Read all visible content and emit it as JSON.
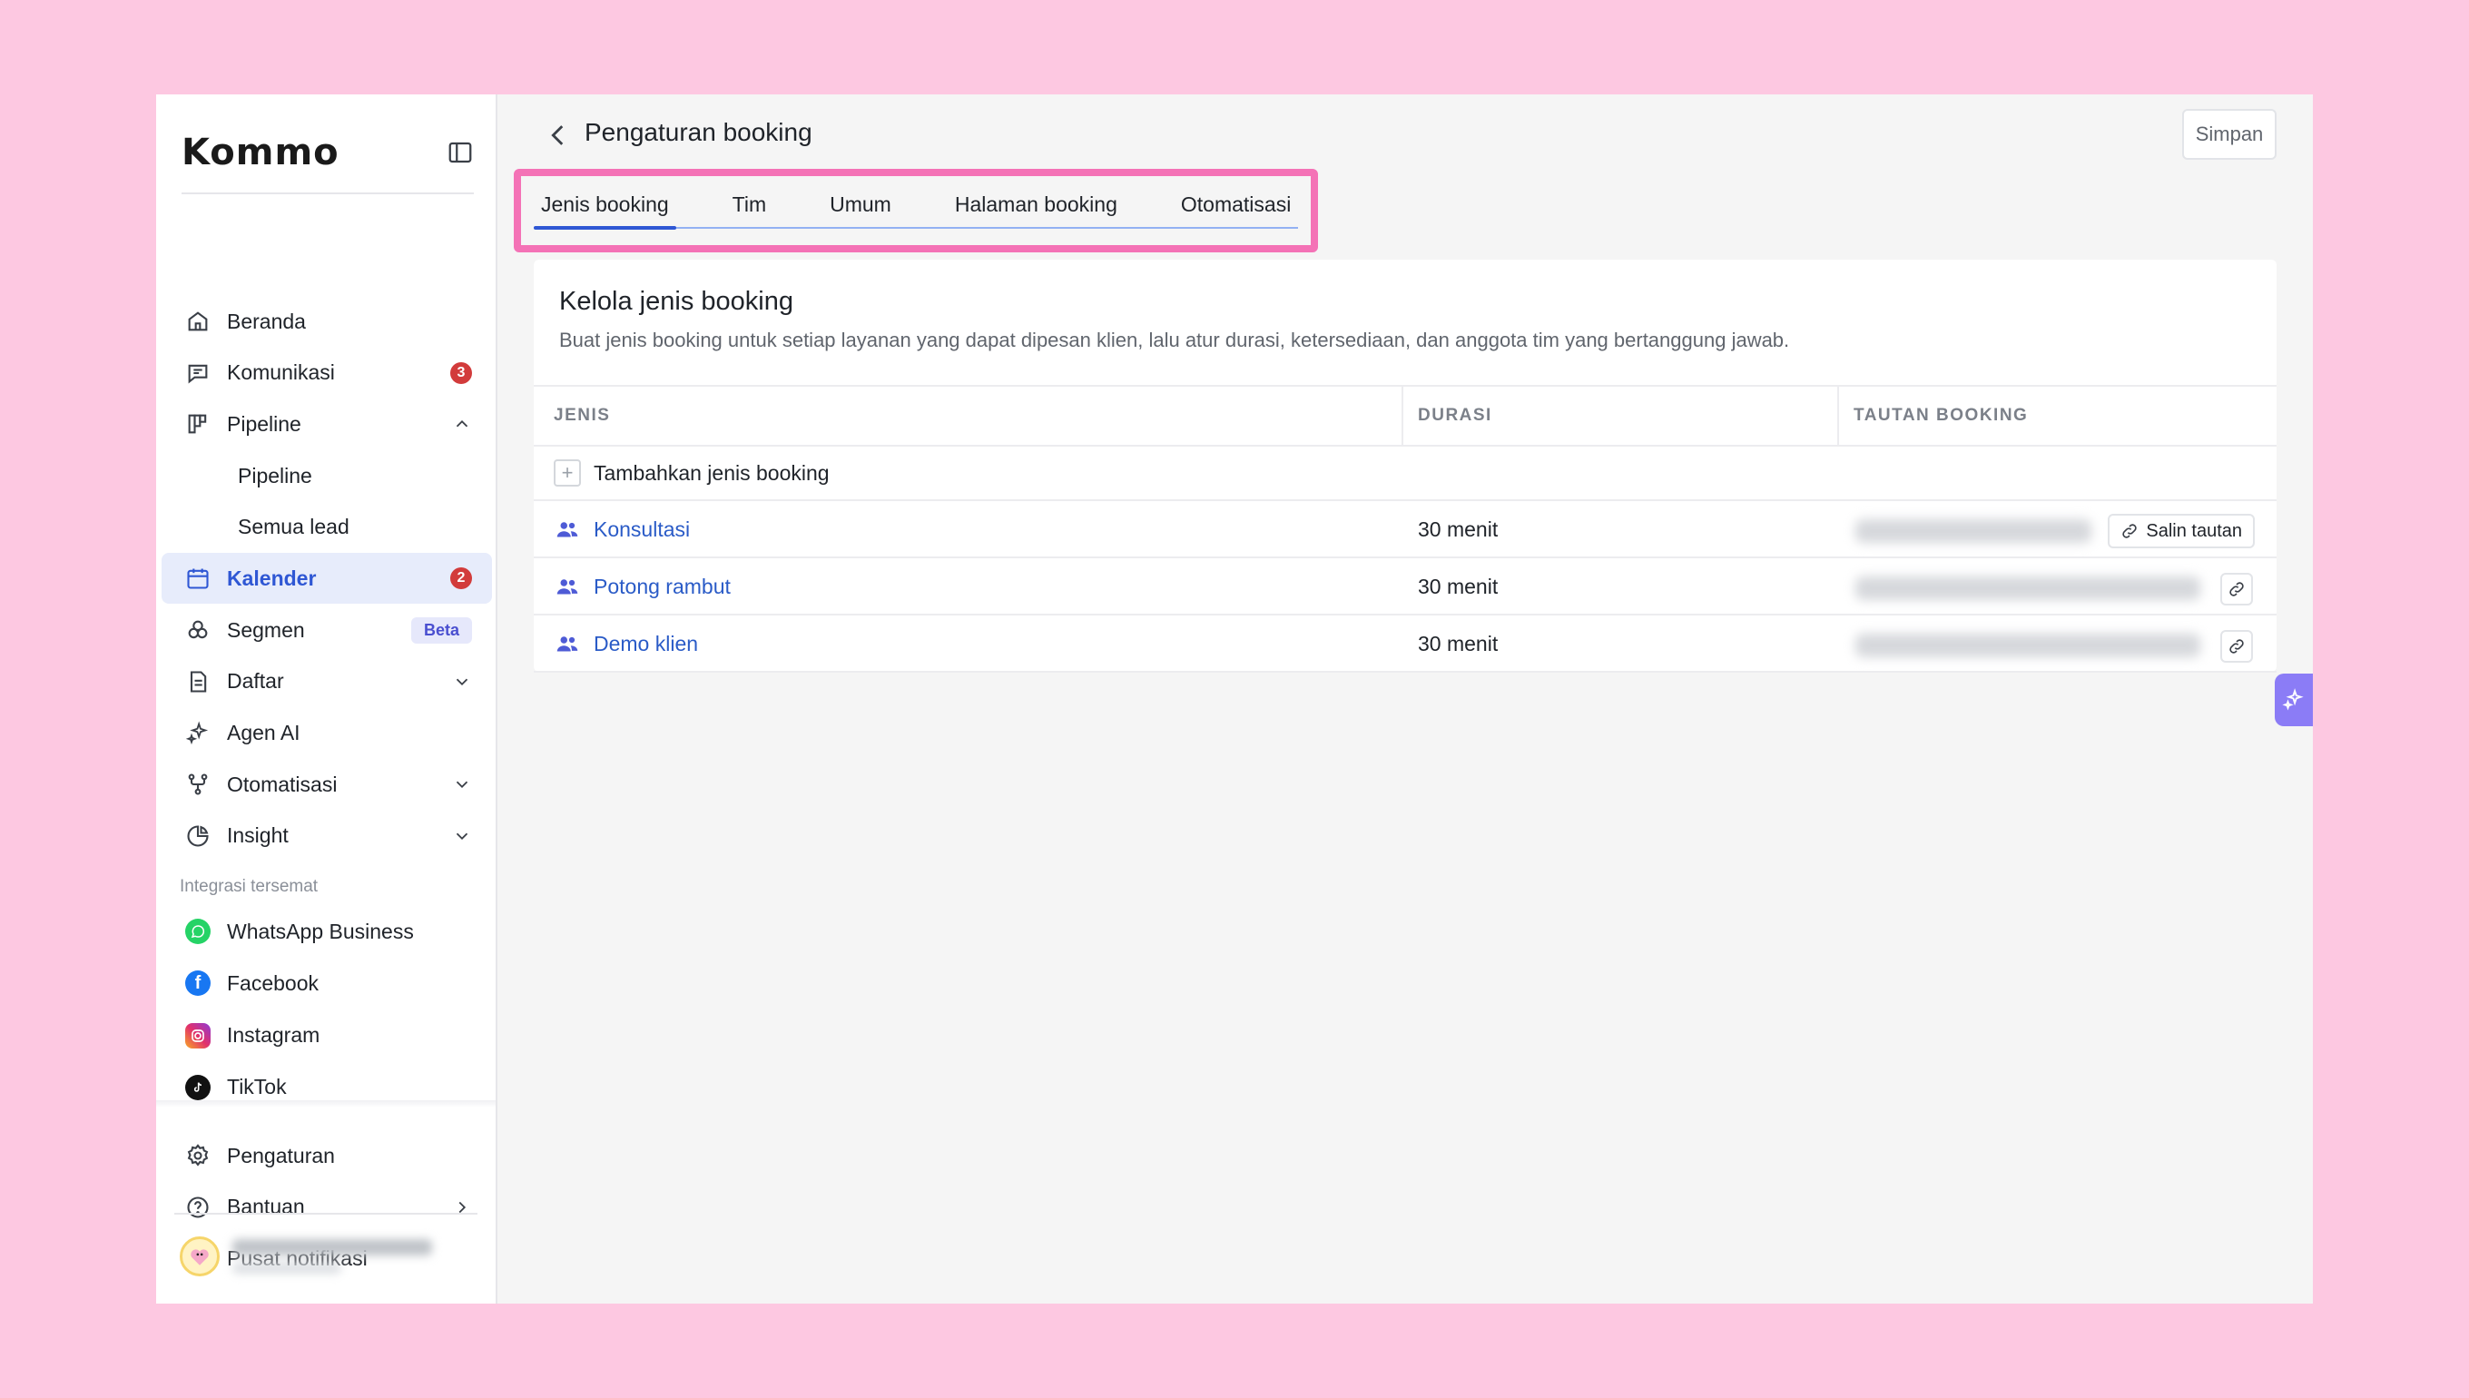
{
  "app": {
    "logo_text": "Kommo"
  },
  "header": {
    "title": "Pengaturan booking",
    "save_label": "Simpan"
  },
  "tabs": [
    {
      "label": "Jenis booking",
      "active": true
    },
    {
      "label": "Tim",
      "active": false
    },
    {
      "label": "Umum",
      "active": false
    },
    {
      "label": "Halaman booking",
      "active": false
    },
    {
      "label": "Otomatisasi",
      "active": false
    }
  ],
  "sidebar": {
    "items": [
      {
        "label": "Beranda",
        "icon": "home-icon"
      },
      {
        "label": "Komunikasi",
        "icon": "chat-icon",
        "badge": "3"
      },
      {
        "label": "Pipeline",
        "icon": "pipeline-icon",
        "expanded": true
      },
      {
        "label": "Pipeline",
        "sub": true
      },
      {
        "label": "Semua lead",
        "sub": true
      },
      {
        "label": "Kalender",
        "icon": "calendar-icon",
        "badge": "2",
        "active": true
      },
      {
        "label": "Segmen",
        "icon": "segment-icon",
        "tag": "Beta"
      },
      {
        "label": "Daftar",
        "icon": "list-icon"
      },
      {
        "label": "Agen AI",
        "icon": "sparkle-icon"
      },
      {
        "label": "Otomatisasi",
        "icon": "automation-icon"
      },
      {
        "label": "Insight",
        "icon": "chart-icon"
      }
    ],
    "integrations_label": "Integrasi tersemat",
    "integrations": [
      {
        "label": "WhatsApp Business",
        "icon": "whatsapp-icon",
        "color": "#25d366"
      },
      {
        "label": "Facebook",
        "icon": "facebook-icon",
        "color": "#1877f2"
      },
      {
        "label": "Instagram",
        "icon": "instagram-icon",
        "color": "#e1306c"
      },
      {
        "label": "TikTok",
        "icon": "tiktok-icon",
        "color": "#111111"
      }
    ],
    "bottom": [
      {
        "label": "Pengaturan",
        "icon": "gear-icon"
      },
      {
        "label": "Bantuan",
        "icon": "help-icon"
      },
      {
        "label": "Pusat notifikasi",
        "icon": "bell-icon"
      }
    ]
  },
  "card": {
    "title": "Kelola jenis booking",
    "description": "Buat jenis booking untuk setiap layanan yang dapat dipesan klien, lalu atur durasi, ketersediaan, dan anggota tim yang bertanggung jawab."
  },
  "table": {
    "columns": [
      "JENIS",
      "DURASI",
      "TAUTAN BOOKING"
    ],
    "add_label": "Tambahkan jenis booking",
    "copy_label": "Salin tautan",
    "rows": [
      {
        "name": "Konsultasi",
        "duration": "30 menit"
      },
      {
        "name": "Potong rambut",
        "duration": "30 menit"
      },
      {
        "name": "Demo klien",
        "duration": "30 menit"
      }
    ]
  },
  "colors": {
    "background": "#fdc8e1",
    "accent": "#2f57d4",
    "highlight": "#f472b6",
    "badge": "#d23b3b"
  }
}
